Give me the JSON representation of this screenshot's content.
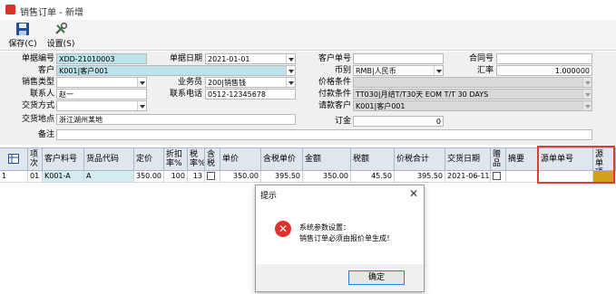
{
  "window": {
    "title": "销售订单 - 新增"
  },
  "toolbar": {
    "save_label": "保存(C)",
    "settings_label": "设置(S)"
  },
  "form": {
    "doc_no_label": "单据编号",
    "doc_no": "XDD-21010003",
    "doc_date_label": "单据日期",
    "doc_date": "2021-01-01",
    "cust_order_label": "客户单号",
    "cust_order": "",
    "contract_label": "合同号",
    "contract": "",
    "customer_label": "客户",
    "customer": "K001|客户001",
    "currency_label": "币别",
    "currency": "RMB|人民币",
    "rate_label": "汇率",
    "rate": "1.000000",
    "sales_type_label": "销售类型",
    "sales_type": "",
    "salesman_label": "业务员",
    "salesman": "200|销售钱",
    "price_cond_label": "价格条件",
    "price_cond": "",
    "contact_label": "联系人",
    "contact": "赵一",
    "phone_label": "联系电话",
    "phone": "0512-12345678",
    "pay_cond_label": "付款条件",
    "pay_cond": "TT030|月结T/T30天 EOM T/T 30 DAYS",
    "delivery_method_label": "交货方式",
    "delivery_method": "",
    "bill_cust_label": "请款客户",
    "bill_cust": "K001|客户001",
    "delivery_place_label": "交货地点",
    "delivery_place": "浙江湖州某地",
    "deposit_label": "订金",
    "deposit": "0",
    "remark_label": "备注",
    "remark": ""
  },
  "grid": {
    "headers": [
      "项次",
      "客户料号",
      "货品代码",
      "定价",
      "折扣率%",
      "税率%",
      "含税",
      "单价",
      "含税单价",
      "金额",
      "税额",
      "价税合计",
      "交货日期",
      "赠品",
      "摘要",
      "源单单号",
      "源单项次"
    ],
    "row": {
      "rownum": "1",
      "seq": "01",
      "cust_part": "K001-A",
      "item_code": "A",
      "list_price": "350.00",
      "discount": "100",
      "tax_rate": "13",
      "unit_price": "350.00",
      "tax_unit_price": "395.50",
      "amount": "350.00",
      "tax": "45.50",
      "total": "395.50",
      "delivery_date": "2021-06-11",
      "summary": "",
      "src_no": "",
      "src_seq": ""
    }
  },
  "dialog": {
    "title": "提示",
    "line1": "系统参数设置：",
    "line2": "销售订单必须由报价单生成！",
    "ok_label": "确定"
  }
}
